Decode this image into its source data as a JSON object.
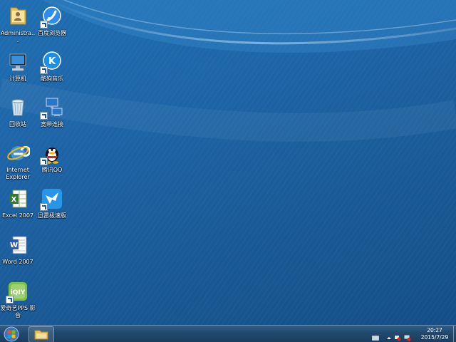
{
  "desktop": {
    "icons": [
      {
        "label": "Administra...",
        "icon": "user-folder-icon"
      },
      {
        "label": "百度浏览器",
        "icon": "baidu-browser-icon"
      },
      {
        "label": "计算机",
        "icon": "computer-icon"
      },
      {
        "label": "酷狗音乐",
        "icon": "kugou-music-icon"
      },
      {
        "label": "回收站",
        "icon": "recycle-bin-icon"
      },
      {
        "label": "宽带连接",
        "icon": "network-connection-icon"
      },
      {
        "label": "Internet Explorer",
        "icon": "internet-explorer-icon"
      },
      {
        "label": "腾讯QQ",
        "icon": "qq-icon"
      },
      {
        "label": "Excel 2007",
        "icon": "excel-icon"
      },
      {
        "label": "迅雷极速版",
        "icon": "xunlei-icon"
      },
      {
        "label": "Word 2007",
        "icon": "word-icon"
      },
      {
        "label": "爱奇艺PPS 影音",
        "icon": "iqiyi-pps-icon"
      }
    ]
  },
  "taskbar": {
    "start_icon": "windows-start-icon",
    "pinned": "file-explorer-icon",
    "clock": {
      "time": "20:27",
      "date": "2015/7/29"
    }
  },
  "colors": {
    "desktop": "#1d64a6",
    "taskbar": "#21486c"
  }
}
